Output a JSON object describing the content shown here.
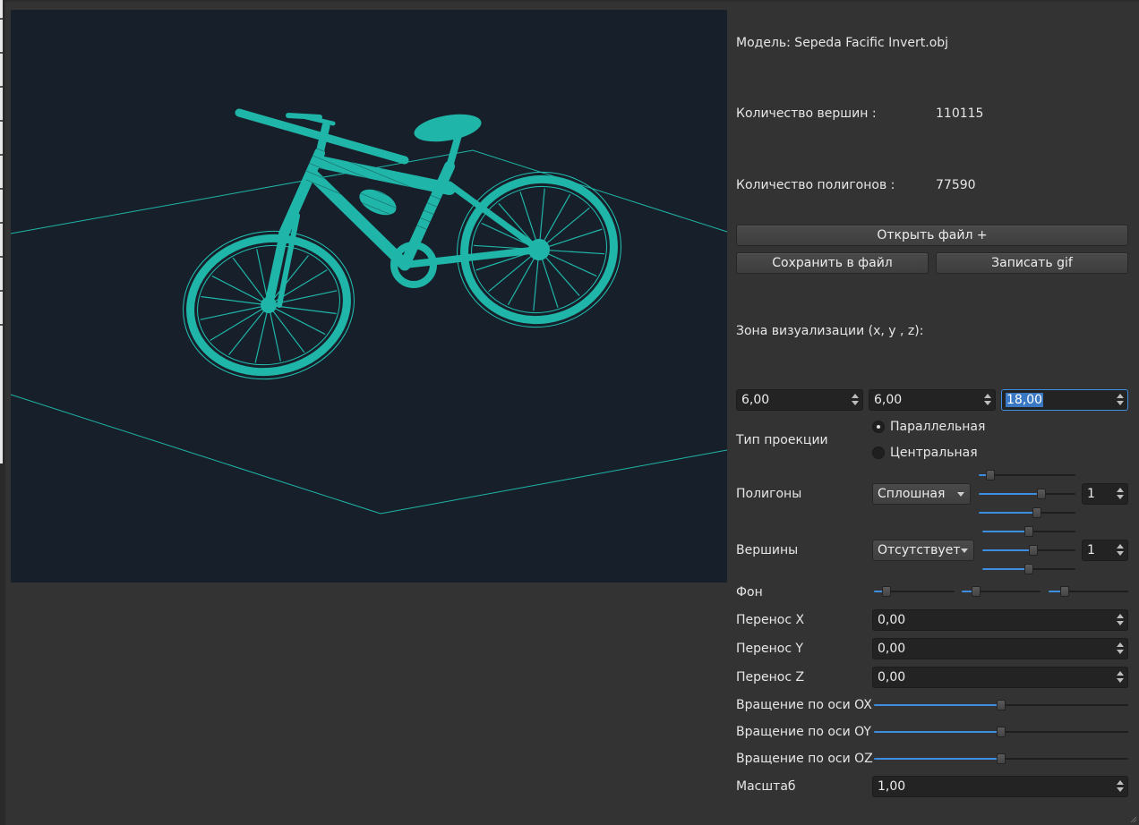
{
  "model_label": "Модель: Sepeda Facific Invert.obj",
  "vertices": {
    "label": "Количество вершин :",
    "value": "110115"
  },
  "polygons_count": {
    "label": "Количество полигонов :",
    "value": "77590"
  },
  "buttons": {
    "open_file": "Открыть файл +",
    "save_file": "Сохранить в файл",
    "record_gif": "Записать gif"
  },
  "viz_zone": {
    "label": "Зона визуализации (x, y , z):",
    "x": "6,00",
    "y": "6,00",
    "z": "18,00"
  },
  "projection": {
    "label": "Тип проекции",
    "options": [
      "Параллельная",
      "Центральная"
    ],
    "selected": "Параллельная"
  },
  "polygons": {
    "label": "Полигоны",
    "mode": "Сплошная",
    "thickness": "1",
    "color_levels": [
      0.12,
      0.65,
      0.6
    ]
  },
  "vertex_settings": {
    "label": "Вершины",
    "mode": "Отсутствует",
    "size": "1",
    "color_levels": [
      0.5,
      0.55,
      0.5
    ]
  },
  "background": {
    "label": "Фон",
    "color_levels": [
      0.15,
      0.18,
      0.2
    ]
  },
  "translate": {
    "x_label": "Перенос X",
    "x": "0,00",
    "y_label": "Перенос Y",
    "y": "0,00",
    "z_label": "Перенос Z",
    "z": "0,00"
  },
  "rotation": {
    "ox_label": "Вращение по оси OX",
    "ox": 0.5,
    "oy_label": "Вращение по оси OY",
    "oy": 0.5,
    "oz_label": "Вращение по оси OZ",
    "oz": 0.5
  },
  "scale": {
    "label": "Масштаб",
    "value": "1,00"
  },
  "colors": {
    "window_bg": "#333333",
    "viewport_bg": "#17202a",
    "model_color": "#1fb5a8",
    "slider_accent": "#3d8ee0"
  }
}
